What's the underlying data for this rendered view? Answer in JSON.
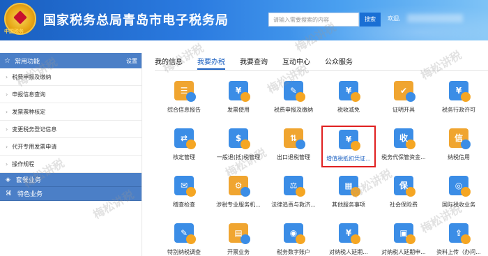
{
  "header": {
    "emblem_text": "中国税务",
    "title": "国家税务总局青岛市电子税务局",
    "search_placeholder": "请输入需要搜索的内容",
    "search_button": "搜索",
    "welcome": "欢迎,"
  },
  "sidebar": {
    "header_title": "常用功能",
    "settings": "设置",
    "items": [
      {
        "label": "税费申报及缴纳"
      },
      {
        "label": "申报信息查询"
      },
      {
        "label": "发票票种核定"
      },
      {
        "label": "变更税务登记信息"
      },
      {
        "label": "代开专用发票申请"
      },
      {
        "label": "操作规程"
      }
    ],
    "sections": [
      {
        "label": "套餐业务"
      },
      {
        "label": "特色业务"
      }
    ]
  },
  "tabs": [
    {
      "label": "我的信息",
      "active": false
    },
    {
      "label": "我要办税",
      "active": true
    },
    {
      "label": "我要查询",
      "active": false
    },
    {
      "label": "互动中心",
      "active": false
    },
    {
      "label": "公众服务",
      "active": false
    }
  ],
  "tiles": [
    {
      "label": "综合信息报告",
      "icon": "report-icon",
      "glyph": "☰",
      "color": "#f0a530"
    },
    {
      "label": "发票使用",
      "icon": "invoice-icon",
      "glyph": "¥",
      "color": "#3b8de6"
    },
    {
      "label": "税费申报及缴纳",
      "icon": "tax-declare-icon",
      "glyph": "✎",
      "color": "#3b8de6"
    },
    {
      "label": "税收减免",
      "icon": "tax-relief-icon",
      "glyph": "¥",
      "color": "#3b8de6"
    },
    {
      "label": "证明开具",
      "icon": "certificate-icon",
      "glyph": "✔",
      "color": "#f0a530"
    },
    {
      "label": "税务行政许可",
      "icon": "admin-permit-icon",
      "glyph": "¥",
      "color": "#3b8de6"
    },
    {
      "label": "核定管理",
      "icon": "assessment-icon",
      "glyph": "⇄",
      "color": "#3b8de6"
    },
    {
      "label": "一般退(抵)税管理",
      "icon": "refund-icon",
      "glyph": "$",
      "color": "#3b8de6"
    },
    {
      "label": "出口退税管理",
      "icon": "export-refund-icon",
      "glyph": "⇅",
      "color": "#f0a530"
    },
    {
      "label": "增值税抵扣凭证...",
      "icon": "vat-deduction-icon",
      "glyph": "¥",
      "color": "#3b8de6",
      "highlight": true
    },
    {
      "label": "税务代保管资金...",
      "icon": "custody-fund-icon",
      "glyph": "收",
      "color": "#3b8de6"
    },
    {
      "label": "纳税信用",
      "icon": "tax-credit-icon",
      "glyph": "信",
      "color": "#f0a530"
    },
    {
      "label": "稽查检查",
      "icon": "inspection-icon",
      "glyph": "✉",
      "color": "#3b8de6"
    },
    {
      "label": "涉税专业服务机...",
      "icon": "agency-icon",
      "glyph": "⚙",
      "color": "#f0a530"
    },
    {
      "label": "法律追责与救济...",
      "icon": "legal-icon",
      "glyph": "⚖",
      "color": "#3b8de6"
    },
    {
      "label": "其他服务事项",
      "icon": "other-service-icon",
      "glyph": "▦",
      "color": "#3b8de6"
    },
    {
      "label": "社会保险费",
      "icon": "social-insurance-icon",
      "glyph": "保",
      "color": "#3b8de6"
    },
    {
      "label": "国际税收业务",
      "icon": "intl-tax-icon",
      "glyph": "◎",
      "color": "#3b8de6"
    },
    {
      "label": "特别纳税调查",
      "icon": "special-tax-icon",
      "glyph": "✎",
      "color": "#3b8de6"
    },
    {
      "label": "开票业务",
      "icon": "issue-invoice-icon",
      "glyph": "▤",
      "color": "#f0a530"
    },
    {
      "label": "税务数字账户",
      "icon": "digital-account-icon",
      "glyph": "◉",
      "color": "#3b8de6"
    },
    {
      "label": "对纳税人延期...",
      "icon": "deferral-icon",
      "glyph": "¥",
      "color": "#3b8de6"
    },
    {
      "label": "对纳税人延期申...",
      "icon": "deferral-apply-icon",
      "glyph": "▣",
      "color": "#3b8de6"
    },
    {
      "label": "资料上传（办问...",
      "icon": "upload-icon",
      "glyph": "⇪",
      "color": "#3b8de6"
    }
  ],
  "watermark": "梅松讲税"
}
